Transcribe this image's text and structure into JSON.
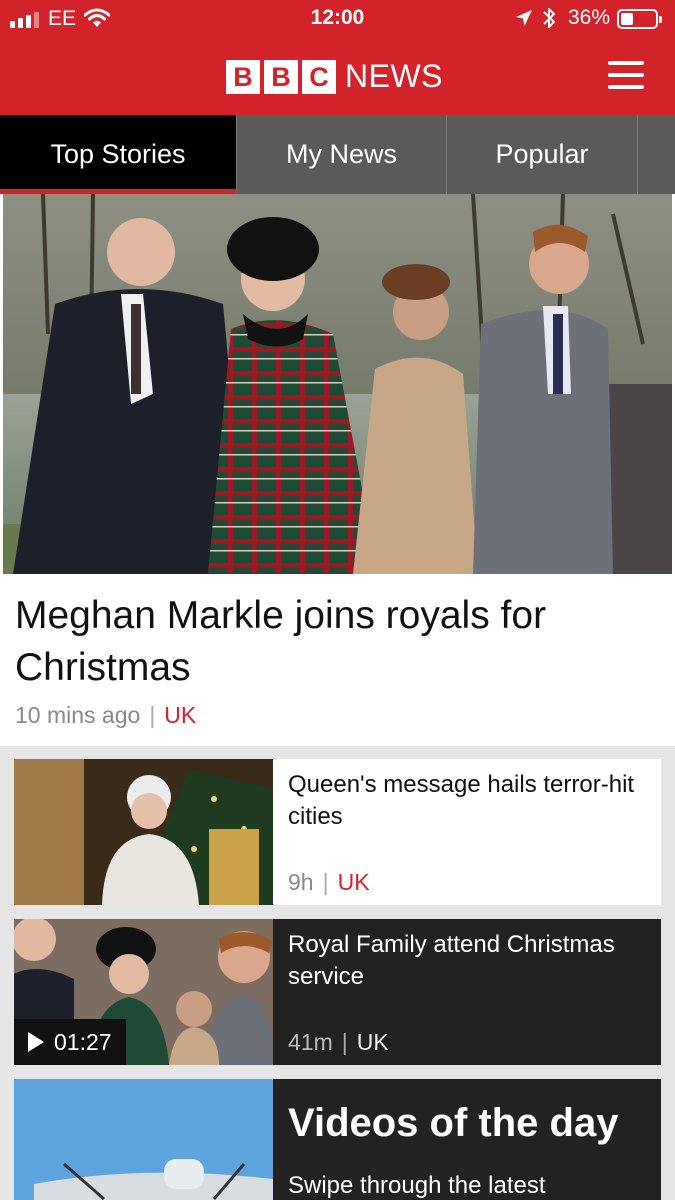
{
  "status_bar": {
    "carrier": "EE",
    "time": "12:00",
    "battery_percent": "36%",
    "battery_level": 0.36
  },
  "header": {
    "logo_letters": [
      "B",
      "B",
      "C"
    ],
    "logo_word": "NEWS"
  },
  "tabs": [
    {
      "label": "Top Stories",
      "active": true
    },
    {
      "label": "My News",
      "active": false
    },
    {
      "label": "Popular",
      "active": false
    }
  ],
  "hero": {
    "title": "Meghan Markle joins royals for Christmas",
    "time": "10 mins ago",
    "category": "UK"
  },
  "stories": [
    {
      "title": "Queen's message hails terror-hit cities",
      "time": "9h",
      "category": "UK",
      "style": "light"
    },
    {
      "title": "Royal Family attend Christmas service",
      "time": "41m",
      "category": "UK",
      "style": "dark",
      "video_duration": "01:27"
    }
  ],
  "feature": {
    "title": "Videos of the day",
    "subtitle": "Swipe through the latest"
  },
  "colors": {
    "brand_red": "#d2232a",
    "tab_bar": "#5a5a5a",
    "dark_card": "#222222"
  }
}
